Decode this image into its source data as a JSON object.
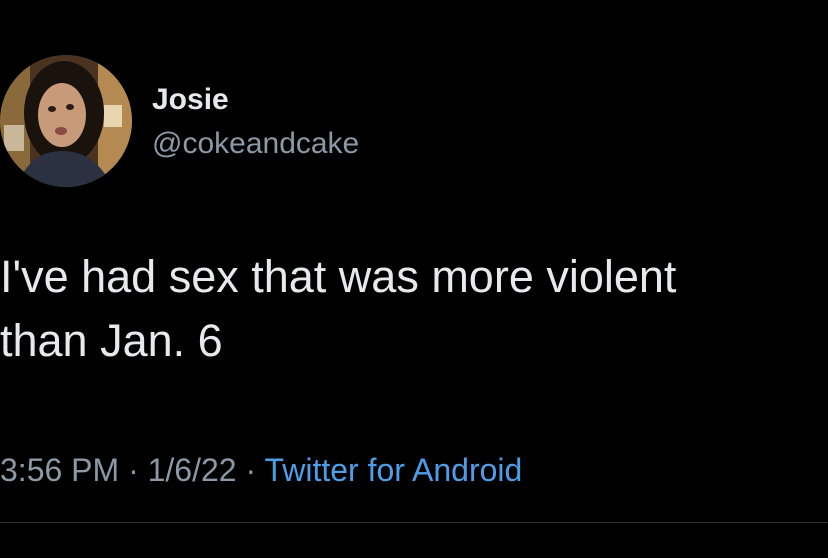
{
  "author": {
    "display_name": "Josie",
    "handle": "@cokeandcake"
  },
  "tweet": {
    "text": "I've had sex that was more violent\nthan Jan. 6",
    "time": "3:56 PM",
    "separator": " · ",
    "date": "1/6/22",
    "source": "Twitter for Android"
  },
  "colors": {
    "background": "#000000",
    "text": "#e7e9ea",
    "secondary": "#8b98a5",
    "link": "#4d9ee8"
  }
}
